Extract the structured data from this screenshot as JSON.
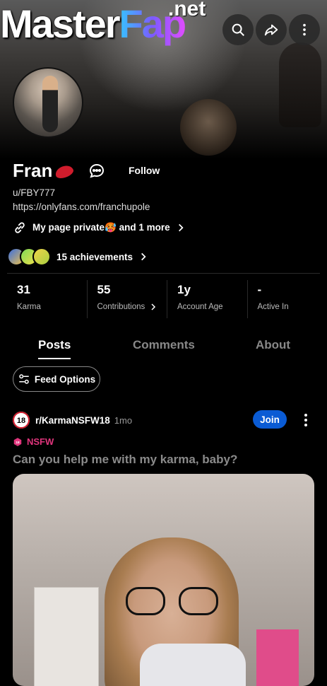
{
  "header": {
    "logo_master": "Master",
    "logo_fap": "Fap",
    "logo_net": ".net"
  },
  "profile": {
    "display_name": "Fran",
    "follow_label": "Follow",
    "username": "u/FBY777",
    "link": "https://onlyfans.com/franchupole",
    "social_links_label": "My page private🥵 and 1 more",
    "achievements_label": "15 achievements"
  },
  "stats": [
    {
      "value": "31",
      "label": "Karma"
    },
    {
      "value": "55",
      "label": "Contributions"
    },
    {
      "value": "1y",
      "label": "Account Age"
    },
    {
      "value": "-",
      "label": "Active In"
    }
  ],
  "tabs": [
    {
      "label": "Posts",
      "active": true
    },
    {
      "label": "Comments",
      "active": false
    },
    {
      "label": "About",
      "active": false
    }
  ],
  "feed_options_label": "Feed Options",
  "post": {
    "subreddit_badge": "18",
    "subreddit": "r/KarmaNSFW18",
    "time": "1mo",
    "join_label": "Join",
    "nsfw_label": "NSFW",
    "title": "Can you help me with my karma, baby?"
  },
  "colors": {
    "join": "#0a5bd4",
    "nsfw": "#e0357c",
    "background": "#000000"
  }
}
